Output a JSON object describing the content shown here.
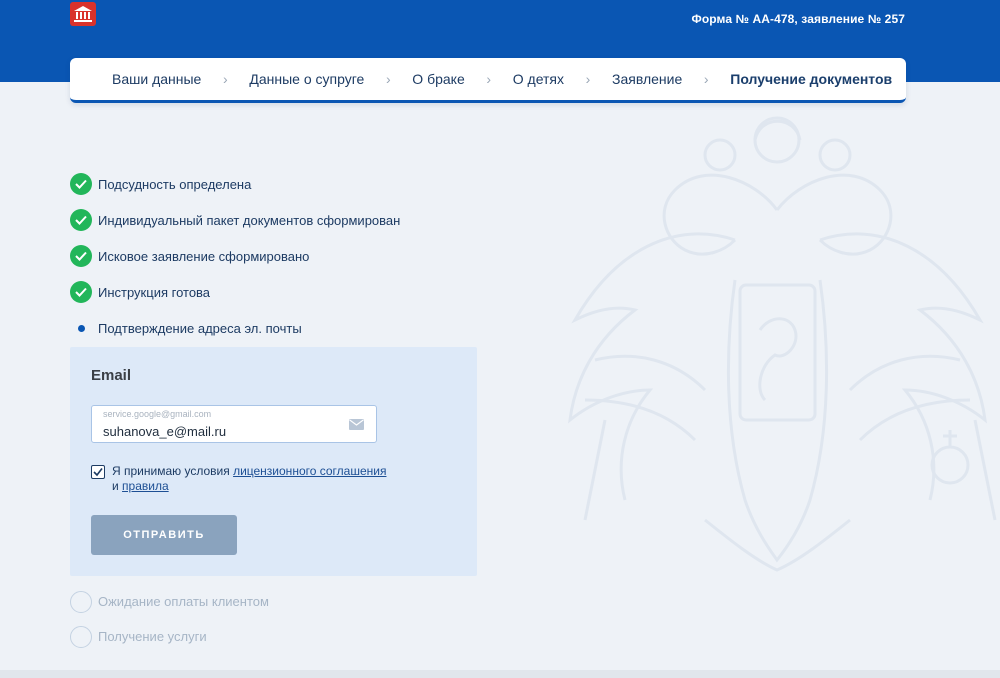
{
  "header": {
    "form_id": "Форма № АА-478, заявление № 257",
    "logo_icon": "courthouse-icon"
  },
  "steps": [
    {
      "label": "Ваши данные",
      "active": false
    },
    {
      "label": "Данные о супруге",
      "active": false
    },
    {
      "label": "О браке",
      "active": false
    },
    {
      "label": "О детях",
      "active": false
    },
    {
      "label": "Заявление",
      "active": false
    },
    {
      "label": "Получение документов",
      "active": true
    }
  ],
  "checklist": {
    "done": [
      "Подсудность определена",
      "Индивидуальный пакет документов сформирован",
      "Исковое заявление сформировано",
      "Инструкция готова"
    ],
    "current": "Подтверждение адреса эл. почты",
    "pending": [
      "Ожидание оплаты клиентом",
      "Получение услуги"
    ]
  },
  "email_form": {
    "title": "Email",
    "placeholder": "service.google@gmail.com",
    "value": "suhanova_e@mail.ru",
    "agree_prefix": "Я принимаю условия ",
    "agree_link1": "лицензионного соглашения ",
    "agree_mid": "и ",
    "agree_link2": "правила",
    "agree_checked": true,
    "submit_label": "ОТПРАВИТЬ"
  },
  "colors": {
    "header_bg": "#0a56b3",
    "check_green": "#22b65a",
    "card_bg": "#dde9f8",
    "button_disabled": "#8aa3be"
  }
}
